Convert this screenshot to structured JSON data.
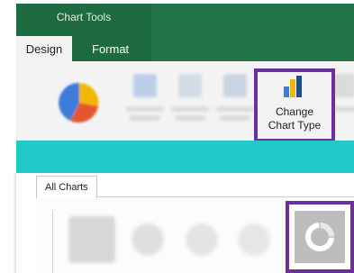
{
  "ribbon": {
    "context_group": "Chart Tools",
    "tabs": [
      {
        "label": "Design",
        "active": true
      },
      {
        "label": "Format",
        "active": false
      }
    ],
    "change_chart_type": {
      "line1": "Change",
      "line2": "Chart Type",
      "icon": "bar-chart-icon"
    }
  },
  "dialog": {
    "tabs": [
      {
        "label": "All Charts",
        "active": true
      }
    ],
    "selected_chart_icon": "doughnut-chart-icon"
  },
  "colors": {
    "ribbon_green": "#217346",
    "highlight_purple": "#6b2fa0",
    "banner_teal": "#22c8c8"
  }
}
